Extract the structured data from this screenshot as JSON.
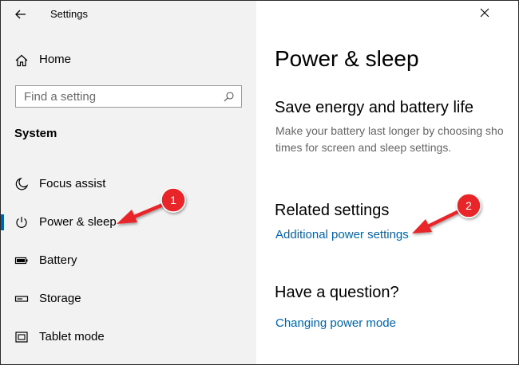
{
  "window": {
    "title": "Settings"
  },
  "sidebar": {
    "home_label": "Home",
    "search_placeholder": "Find a setting",
    "section_title": "System",
    "items": [
      {
        "label": "Focus assist",
        "icon": "moon-icon",
        "active": false
      },
      {
        "label": "Power & sleep",
        "icon": "power-icon",
        "active": true
      },
      {
        "label": "Battery",
        "icon": "battery-icon",
        "active": false
      },
      {
        "label": "Storage",
        "icon": "storage-icon",
        "active": false
      },
      {
        "label": "Tablet mode",
        "icon": "tablet-mode-icon",
        "active": false
      }
    ]
  },
  "main": {
    "page_title": "Power & sleep",
    "save_energy_heading": "Save energy and battery life",
    "save_energy_desc_line1": "Make your battery last longer by choosing sho",
    "save_energy_desc_line2": "times for screen and sleep settings.",
    "related_heading": "Related settings",
    "related_link": "Additional power settings",
    "question_heading": "Have a question?",
    "question_link": "Changing power mode"
  },
  "annotations": [
    {
      "number": "1",
      "color": "#e8262a"
    },
    {
      "number": "2",
      "color": "#e8262a"
    }
  ],
  "colors": {
    "accent": "#0063b1",
    "sidebar_bg": "#f2f2f2",
    "annotation": "#e8262a"
  }
}
